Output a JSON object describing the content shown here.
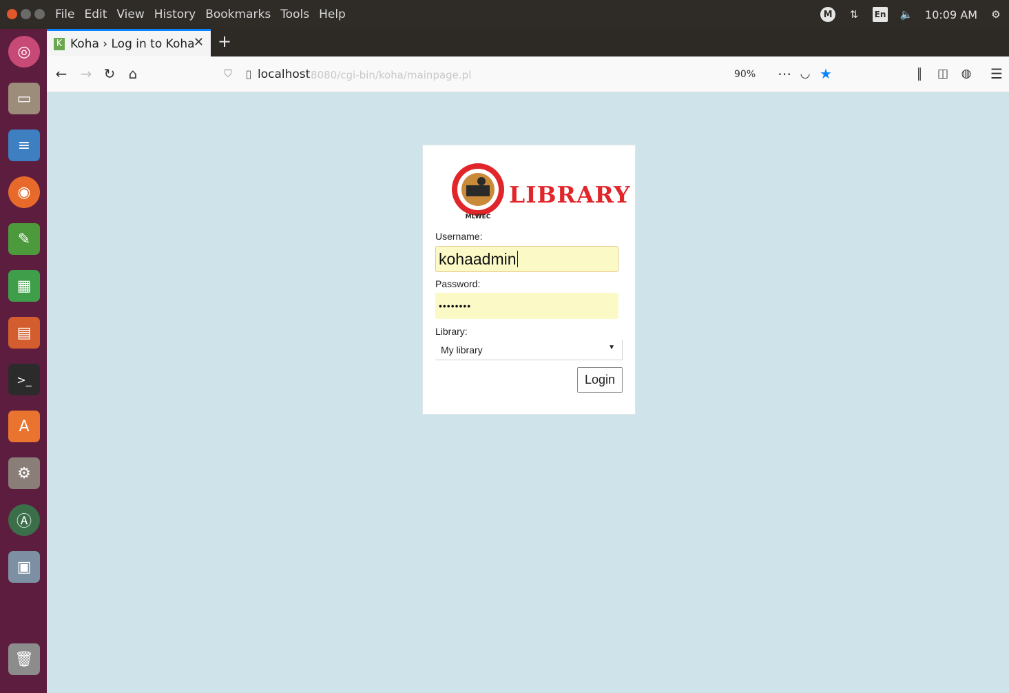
{
  "menubar": {
    "items": [
      "File",
      "Edit",
      "View",
      "History",
      "Bookmarks",
      "Tools",
      "Help"
    ],
    "clock": "10:09 AM",
    "keyboard_layout": "En"
  },
  "browser": {
    "tab_title": "Koha › Log in to Koha",
    "url_host": "localhost",
    "url_path": ":8080/cgi-bin/koha/mainpage.pl",
    "zoom": "90%",
    "accent_color": "#0a84ff"
  },
  "login": {
    "logo_text": "LIBRARY",
    "logo_caption": "MLWEC",
    "username_label": "Username:",
    "username_value": "kohaadmin",
    "password_label": "Password:",
    "password_mask": "••••••••",
    "library_label": "Library:",
    "library_selected": "My library",
    "login_button": "Login"
  },
  "launcher": {
    "icons": [
      "ubuntu-dash-icon",
      "files-icon",
      "writer-doc-icon",
      "firefox-icon",
      "text-editor-icon",
      "calc-spreadsheet-icon",
      "impress-presentation-icon",
      "terminal-icon",
      "software-center-icon",
      "system-settings-icon",
      "software-updater-icon",
      "file-archive-icon",
      "trash-icon"
    ]
  }
}
